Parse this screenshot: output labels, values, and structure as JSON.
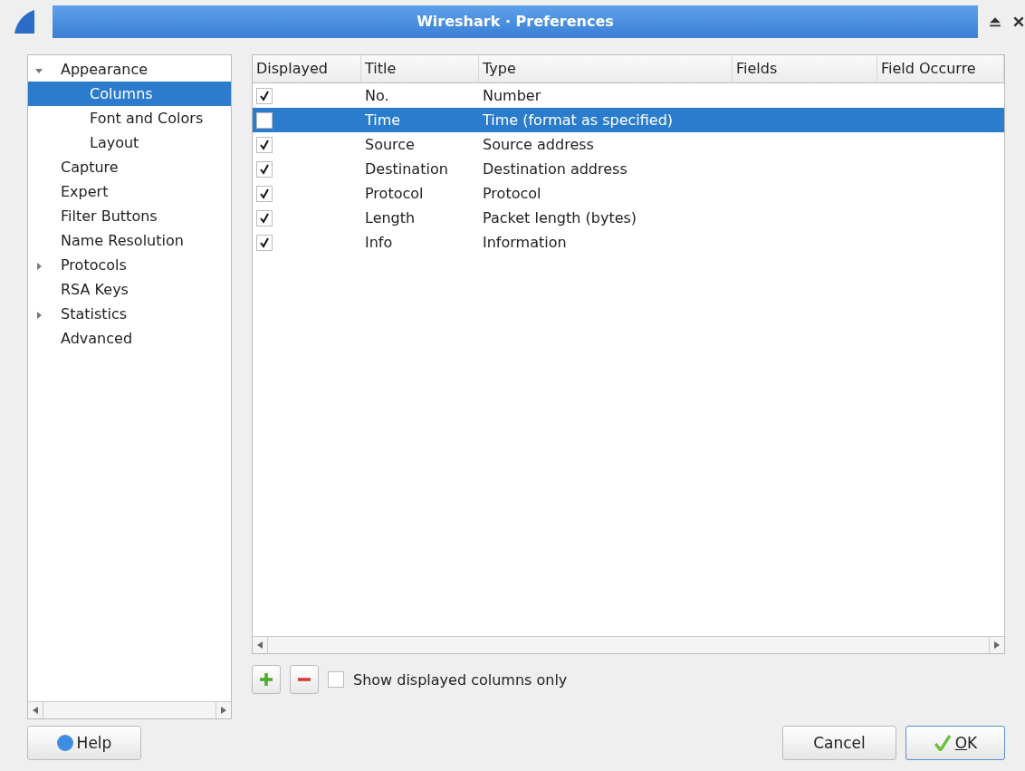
{
  "window": {
    "title": "Wireshark · Preferences"
  },
  "sidebar": {
    "items": [
      {
        "label": "Appearance",
        "selected": false,
        "expanded": true,
        "children": [
          {
            "label": "Columns",
            "selected": true
          },
          {
            "label": "Font and Colors",
            "selected": false
          },
          {
            "label": "Layout",
            "selected": false
          }
        ]
      },
      {
        "label": "Capture",
        "selected": false
      },
      {
        "label": "Expert",
        "selected": false
      },
      {
        "label": "Filter Buttons",
        "selected": false
      },
      {
        "label": "Name Resolution",
        "selected": false
      },
      {
        "label": "Protocols",
        "selected": false,
        "expanded": false
      },
      {
        "label": "RSA Keys",
        "selected": false
      },
      {
        "label": "Statistics",
        "selected": false,
        "expanded": false
      },
      {
        "label": "Advanced",
        "selected": false
      }
    ]
  },
  "table": {
    "columns": [
      "Displayed",
      "Title",
      "Type",
      "Fields",
      "Field Occurre"
    ],
    "rows": [
      {
        "displayed": true,
        "title": "No.",
        "type": "Number",
        "selected": false
      },
      {
        "displayed": false,
        "title": "Time",
        "type": "Time (format as specified)",
        "selected": true
      },
      {
        "displayed": true,
        "title": "Source",
        "type": "Source address",
        "selected": false
      },
      {
        "displayed": true,
        "title": "Destination",
        "type": "Destination address",
        "selected": false
      },
      {
        "displayed": true,
        "title": "Protocol",
        "type": "Protocol",
        "selected": false
      },
      {
        "displayed": true,
        "title": "Length",
        "type": "Packet length (bytes)",
        "selected": false
      },
      {
        "displayed": true,
        "title": "Info",
        "type": "Information",
        "selected": false
      }
    ]
  },
  "show_displayed_only": {
    "label": "Show displayed columns only",
    "checked": false
  },
  "buttons": {
    "help": "Help",
    "cancel": "Cancel",
    "ok": "OK"
  }
}
